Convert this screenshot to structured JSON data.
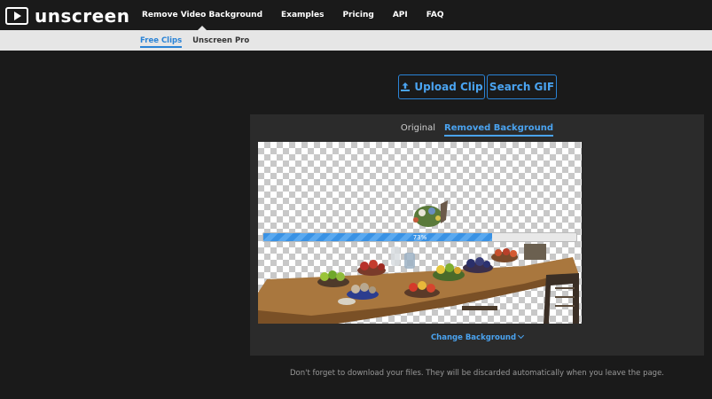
{
  "brand": {
    "name": "unscreen"
  },
  "nav": {
    "items": [
      {
        "label": "Remove Video Background"
      },
      {
        "label": "Examples"
      },
      {
        "label": "Pricing"
      },
      {
        "label": "API"
      },
      {
        "label": "FAQ"
      }
    ]
  },
  "subnav": {
    "items": [
      {
        "label": "Free Clips"
      },
      {
        "label": "Unscreen Pro"
      }
    ]
  },
  "actions": {
    "upload_label": "Upload Clip",
    "search_label": "Search GIF"
  },
  "preview": {
    "tabs": [
      {
        "label": "Original"
      },
      {
        "label": "Removed Background"
      }
    ],
    "progress": {
      "value": 0.73,
      "label": "73%"
    },
    "change_background_label": "Change Background"
  },
  "footer_note": "Don't forget to download your files. They will be discarded automatically when you leave the page.",
  "colors": {
    "accent": "#2a83d6",
    "background": "#1a1a1a",
    "panel": "#2b2b2b"
  },
  "icons": {
    "upload": "upload-icon",
    "chevron": "chevron-down-icon",
    "logo": "play-icon"
  }
}
